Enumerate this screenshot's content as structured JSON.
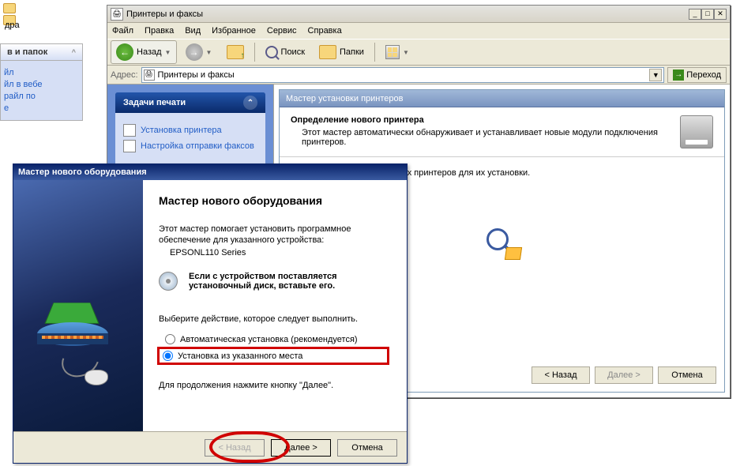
{
  "bg": {
    "folder_label": "дра",
    "tasks_header": "в и папок",
    "collapse": "^",
    "tasks": [
      "йл",
      "",
      "йл в вебе",
      "райл по",
      "е"
    ]
  },
  "pf": {
    "title": "Принтеры и факсы",
    "menu": {
      "file": "Файл",
      "edit": "Правка",
      "view": "Вид",
      "favorites": "Избранное",
      "tools": "Сервис",
      "help": "Справка"
    },
    "toolbar": {
      "back": "Назад",
      "search": "Поиск",
      "folders": "Папки"
    },
    "addressbar": {
      "label": "Адрес:",
      "value": "Принтеры и факсы",
      "go": "Переход"
    },
    "sidebar": {
      "header": "Задачи печати",
      "items": [
        {
          "label": "Установка принтера"
        },
        {
          "label": "Настройка отправки факсов"
        }
      ]
    },
    "wizard": {
      "title": "Мастер установки принтеров",
      "heading": "Определение нового принтера",
      "subheading": "Этот мастер автоматически обнаруживает и устанавливает новые модули подключения принтеров.",
      "body": "ск новых самонастраиваемых принтеров для их установки.",
      "back": "< Назад",
      "next": "Далее >",
      "cancel": "Отмена"
    }
  },
  "hw": {
    "title": "Мастер нового оборудования",
    "heading": "Мастер нового оборудования",
    "para1": "Этот мастер помогает установить программное",
    "para2": "обеспечение для указанного устройства:",
    "device": "EPSONL110 Series",
    "cd_text1": "Если с устройством поставляется",
    "cd_text2": "установочный диск, вставьте его.",
    "select_label": "Выберите действие, которое следует выполнить.",
    "radio_auto": "Автоматическая установка (рекомендуется)",
    "radio_manual": "Установка из указанного места",
    "continue_label": "Для продолжения нажмите кнопку \"Далее\".",
    "back": "< Назад",
    "next": "Далее >",
    "cancel": "Отмена"
  }
}
